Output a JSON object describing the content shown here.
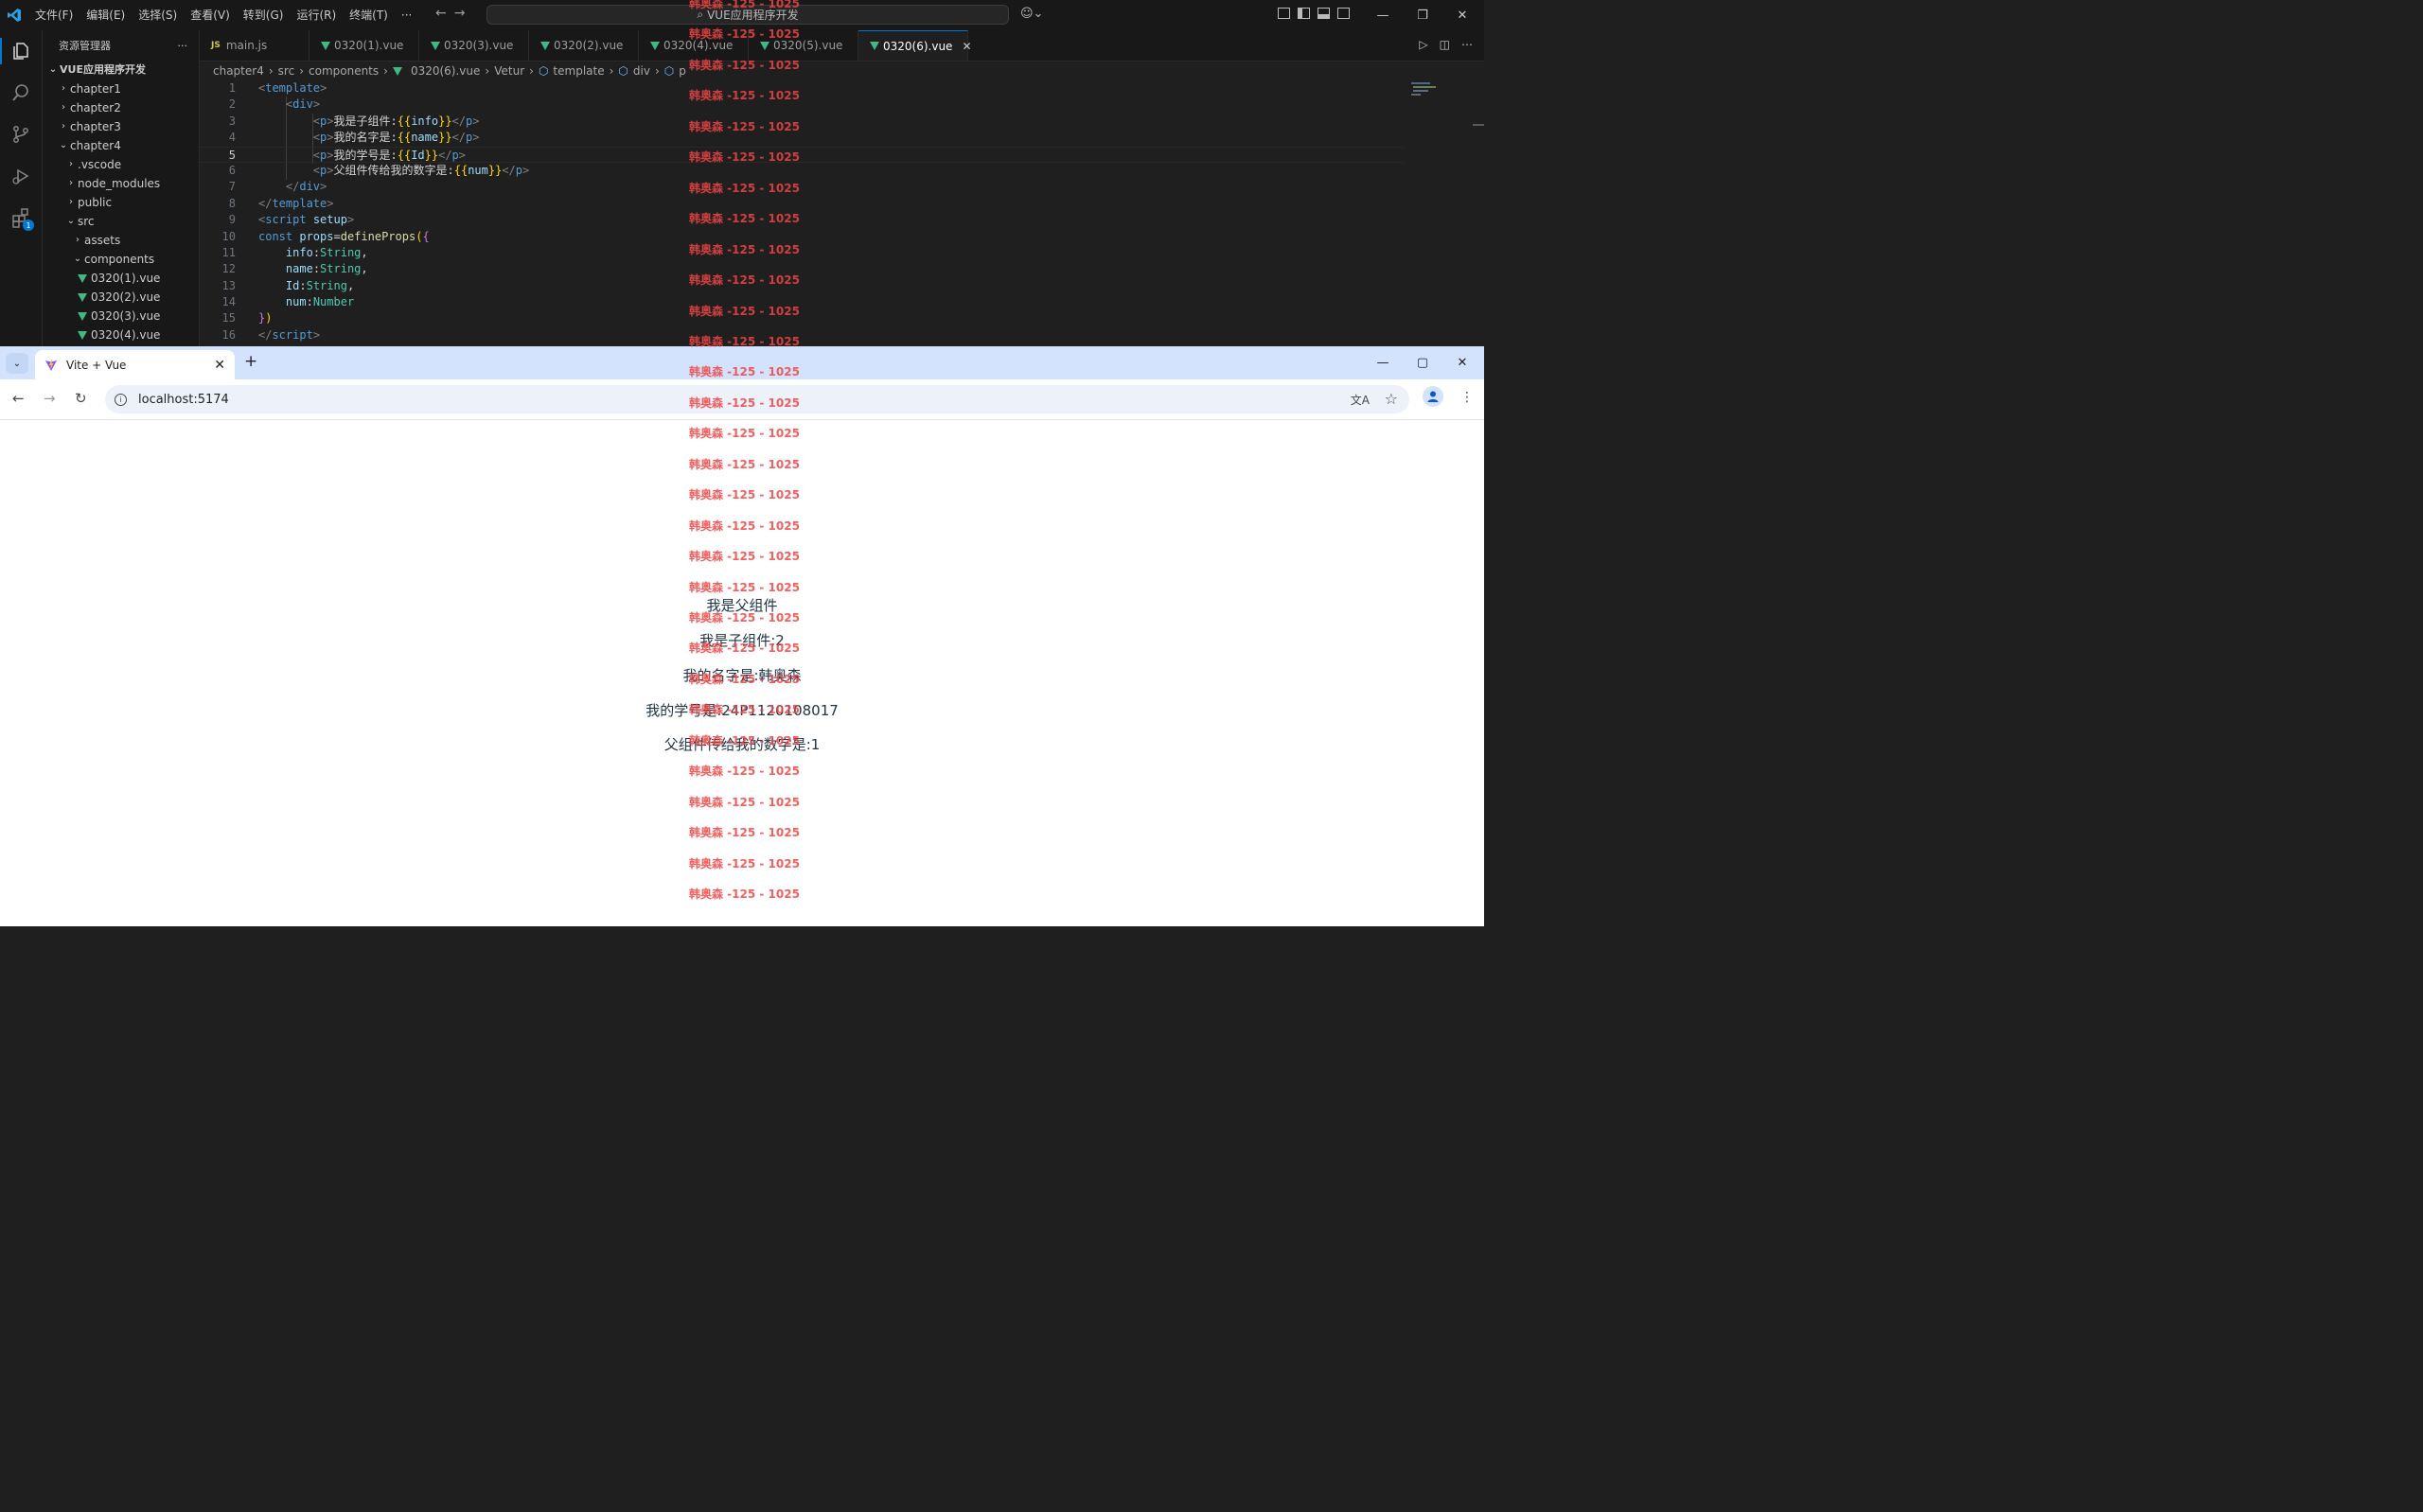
{
  "vscode": {
    "menu": [
      "文件(F)",
      "编辑(E)",
      "选择(S)",
      "查看(V)",
      "转到(G)",
      "运行(R)",
      "终端(T)",
      "···"
    ],
    "search_text": "VUE应用程序开发",
    "explorer_title": "资源管理器",
    "explorer_more": "···",
    "tree": [
      {
        "label": "VUE应用程序开发",
        "depth": 0,
        "chev": "⌄",
        "type": "root"
      },
      {
        "label": "chapter1",
        "depth": 1,
        "chev": "›",
        "type": "folder"
      },
      {
        "label": "chapter2",
        "depth": 1,
        "chev": "›",
        "type": "folder"
      },
      {
        "label": "chapter3",
        "depth": 1,
        "chev": "›",
        "type": "folder"
      },
      {
        "label": "chapter4",
        "depth": 1,
        "chev": "⌄",
        "type": "folder"
      },
      {
        "label": ".vscode",
        "depth": 2,
        "chev": "›",
        "type": "folder"
      },
      {
        "label": "node_modules",
        "depth": 2,
        "chev": "›",
        "type": "folder"
      },
      {
        "label": "public",
        "depth": 2,
        "chev": "›",
        "type": "folder"
      },
      {
        "label": "src",
        "depth": 2,
        "chev": "⌄",
        "type": "folder"
      },
      {
        "label": "assets",
        "depth": 3,
        "chev": "›",
        "type": "folder"
      },
      {
        "label": "components",
        "depth": 3,
        "chev": "⌄",
        "type": "folder"
      },
      {
        "label": "0320(1).vue",
        "depth": 4,
        "chev": "",
        "type": "vue"
      },
      {
        "label": "0320(2).vue",
        "depth": 4,
        "chev": "",
        "type": "vue"
      },
      {
        "label": "0320(3).vue",
        "depth": 4,
        "chev": "",
        "type": "vue"
      },
      {
        "label": "0320(4).vue",
        "depth": 4,
        "chev": "",
        "type": "vue"
      }
    ],
    "tabs": [
      {
        "label": "main.js",
        "icon": "js",
        "active": false
      },
      {
        "label": "0320(1).vue",
        "icon": "vue",
        "active": false
      },
      {
        "label": "0320(3).vue",
        "icon": "vue",
        "active": false
      },
      {
        "label": "0320(2).vue",
        "icon": "vue",
        "active": false
      },
      {
        "label": "0320(4).vue",
        "icon": "vue",
        "active": false
      },
      {
        "label": "0320(5).vue",
        "icon": "vue",
        "active": false
      },
      {
        "label": "0320(6).vue",
        "icon": "vue",
        "active": true
      }
    ],
    "tab_js_badge": "JS",
    "breadcrumb": [
      "chapter4",
      "src",
      "components",
      "0320(6).vue",
      "Vetur",
      "template",
      "div",
      "p"
    ],
    "current_line": 5,
    "code": [
      [
        [
          "t-br",
          "<"
        ],
        [
          "t-tag",
          "template"
        ],
        [
          "t-br",
          ">"
        ]
      ],
      [
        [
          "t-txt",
          "    "
        ],
        [
          "t-br",
          "<"
        ],
        [
          "t-tag",
          "div"
        ],
        [
          "t-br",
          ">"
        ]
      ],
      [
        [
          "t-txt",
          "        "
        ],
        [
          "t-br",
          "<"
        ],
        [
          "t-tag",
          "p"
        ],
        [
          "t-br",
          ">"
        ],
        [
          "t-txt",
          "我是子组件:"
        ],
        [
          "t-mus",
          "{{"
        ],
        [
          "t-var",
          "info"
        ],
        [
          "t-mus",
          "}}"
        ],
        [
          "t-br",
          "</"
        ],
        [
          "t-tag",
          "p"
        ],
        [
          "t-br",
          ">"
        ]
      ],
      [
        [
          "t-txt",
          "        "
        ],
        [
          "t-br",
          "<"
        ],
        [
          "t-tag",
          "p"
        ],
        [
          "t-br",
          ">"
        ],
        [
          "t-txt",
          "我的名字是:"
        ],
        [
          "t-mus",
          "{{"
        ],
        [
          "t-var",
          "name"
        ],
        [
          "t-mus",
          "}}"
        ],
        [
          "t-br",
          "</"
        ],
        [
          "t-tag",
          "p"
        ],
        [
          "t-br",
          ">"
        ]
      ],
      [
        [
          "t-txt",
          "        "
        ],
        [
          "t-br",
          "<"
        ],
        [
          "t-tag",
          "p"
        ],
        [
          "t-br",
          ">"
        ],
        [
          "t-txt",
          "我的学号是:"
        ],
        [
          "t-mus",
          "{{"
        ],
        [
          "t-var",
          "Id"
        ],
        [
          "t-mus",
          "}}"
        ],
        [
          "t-br",
          "</"
        ],
        [
          "t-tag",
          "p"
        ],
        [
          "t-br",
          ">"
        ]
      ],
      [
        [
          "t-txt",
          "        "
        ],
        [
          "t-br",
          "<"
        ],
        [
          "t-tag",
          "p"
        ],
        [
          "t-br",
          ">"
        ],
        [
          "t-txt",
          "父组件传给我的数字是:"
        ],
        [
          "t-mus",
          "{{"
        ],
        [
          "t-var",
          "num"
        ],
        [
          "t-mus",
          "}}"
        ],
        [
          "t-br",
          "</"
        ],
        [
          "t-tag",
          "p"
        ],
        [
          "t-br",
          ">"
        ]
      ],
      [
        [
          "t-txt",
          "    "
        ],
        [
          "t-br",
          "</"
        ],
        [
          "t-tag",
          "div"
        ],
        [
          "t-br",
          ">"
        ]
      ],
      [
        [
          "t-br",
          "</"
        ],
        [
          "t-tag",
          "template"
        ],
        [
          "t-br",
          ">"
        ]
      ],
      [
        [
          "t-br",
          "<"
        ],
        [
          "t-tag",
          "script"
        ],
        [
          "t-txt",
          " "
        ],
        [
          "t-var",
          "setup"
        ],
        [
          "t-br",
          ">"
        ]
      ],
      [
        [
          "t-kw",
          "const"
        ],
        [
          "t-txt",
          " "
        ],
        [
          "t-var",
          "props"
        ],
        [
          "t-txt",
          "="
        ],
        [
          "t-fn",
          "defineProps"
        ],
        [
          "t-mus",
          "("
        ],
        [
          "t-br2",
          "{"
        ]
      ],
      [
        [
          "t-txt",
          "    "
        ],
        [
          "t-var",
          "info"
        ],
        [
          "t-txt",
          ":"
        ],
        [
          "t-ty",
          "String"
        ],
        [
          "t-txt",
          ","
        ]
      ],
      [
        [
          "t-txt",
          "    "
        ],
        [
          "t-var",
          "name"
        ],
        [
          "t-txt",
          ":"
        ],
        [
          "t-ty",
          "String"
        ],
        [
          "t-txt",
          ","
        ]
      ],
      [
        [
          "t-txt",
          "    "
        ],
        [
          "t-var",
          "Id"
        ],
        [
          "t-txt",
          ":"
        ],
        [
          "t-ty",
          "String"
        ],
        [
          "t-txt",
          ","
        ]
      ],
      [
        [
          "t-txt",
          "    "
        ],
        [
          "t-var",
          "num"
        ],
        [
          "t-txt",
          ":"
        ],
        [
          "t-ty",
          "Number"
        ]
      ],
      [
        [
          "t-br2",
          "}"
        ],
        [
          "t-mus",
          ")"
        ]
      ],
      [
        [
          "t-br",
          "</"
        ],
        [
          "t-tag",
          "script"
        ],
        [
          "t-br",
          ">"
        ]
      ]
    ]
  },
  "chrome": {
    "tab_title": "Vite + Vue",
    "url": "localhost:5174"
  },
  "app_output": [
    "我是父组件",
    "我是子组件:2",
    "我的名字是:韩奥森",
    "我的学号是:24P1120108017",
    "父组件传给我的数字是:1"
  ],
  "watermark_text": "韩奥森 -125 - 1025",
  "colors": {
    "vscode_bg": "#1f1f1f",
    "accent": "#0078d4",
    "vue_green": "#41b883",
    "chrome_tabstrip": "#d3e3fd",
    "watermark": "#f04545",
    "page_text": "#213547"
  }
}
